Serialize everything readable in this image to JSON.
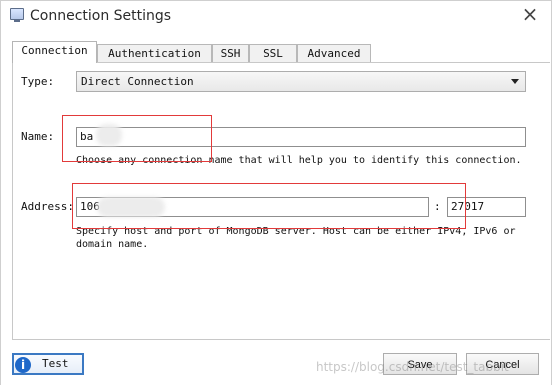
{
  "window": {
    "title": "Connection Settings",
    "icon": "app-window-icon",
    "close_icon": "close-icon"
  },
  "tabs": [
    {
      "label": "Connection",
      "active": true
    },
    {
      "label": "Authentication",
      "active": false
    },
    {
      "label": "SSH",
      "active": false
    },
    {
      "label": "SSL",
      "active": false
    },
    {
      "label": "Advanced",
      "active": false
    }
  ],
  "form": {
    "type_label": "Type:",
    "type_value": "Direct Connection",
    "name_label": "Name:",
    "name_value": "ba",
    "name_hint": "Choose any connection name that will help you to identify this connection.",
    "address_label": "Address:",
    "host_value": "106",
    "port_separator": ":",
    "port_value": "27017",
    "address_hint_line1": "Specify host and port of MongoDB server. Host can be either IPv4, IPv6 or",
    "address_hint_line2": "domain name."
  },
  "footer": {
    "test_label": "Test",
    "save_label": "Save",
    "cancel_label": "Cancel"
  },
  "watermark": "https://blog.csdn.net/test_tabbit",
  "colors": {
    "annotation_red": "#e23a3a",
    "focus_blue": "#3b79c3",
    "info_blue": "#1f68c9"
  }
}
